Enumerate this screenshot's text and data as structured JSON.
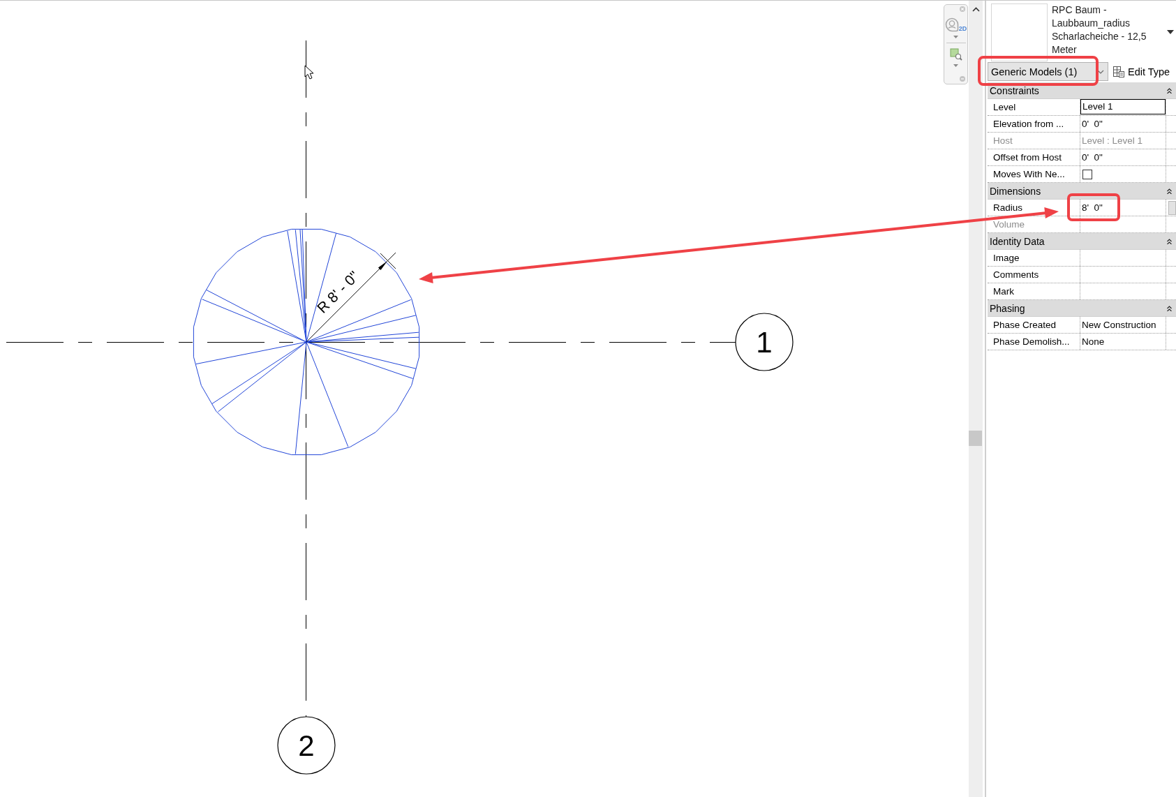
{
  "canvas": {
    "grids": [
      {
        "label": "1",
        "kind": "horizontal"
      },
      {
        "label": "2",
        "kind": "vertical"
      }
    ],
    "dimension": {
      "label": "R 8' - 0\""
    }
  },
  "navigation_bar": {
    "wheel_label": "2D"
  },
  "properties": {
    "type_name": "RPC Baum - Laubbaum_radius Scharlacheiche - 12,5 Meter",
    "category_filter": "Generic Models (1)",
    "edit_type_button": "Edit Type",
    "sections": [
      {
        "title": "Constraints",
        "expanded": true,
        "rows": [
          {
            "name": "Level",
            "kind": "input",
            "value": "Level 1",
            "disabled": false
          },
          {
            "name": "Elevation from ...",
            "kind": "text",
            "value": "0'  0\"",
            "disabled": false
          },
          {
            "name": "Host",
            "kind": "text",
            "value": "Level : Level 1",
            "disabled": true
          },
          {
            "name": "Offset from Host",
            "kind": "text",
            "value": "0'  0\"",
            "disabled": false
          },
          {
            "name": "Moves With Ne...",
            "kind": "checkbox",
            "checked": false,
            "disabled": false
          }
        ]
      },
      {
        "title": "Dimensions",
        "expanded": true,
        "rows": [
          {
            "name": "Radius",
            "kind": "text",
            "value": "8'  0\"",
            "disabled": false
          },
          {
            "name": "Volume",
            "kind": "text",
            "disabled": true
          }
        ]
      },
      {
        "title": "Identity Data",
        "expanded": true,
        "rows": [
          {
            "name": "Image",
            "kind": "text",
            "disabled": false
          },
          {
            "name": "Comments",
            "kind": "text",
            "disabled": false
          },
          {
            "name": "Mark",
            "kind": "text",
            "disabled": false
          }
        ]
      },
      {
        "title": "Phasing",
        "expanded": true,
        "rows": [
          {
            "name": "Phase Created",
            "kind": "text",
            "value": "New Construction",
            "disabled": false
          },
          {
            "name": "Phase Demolish...",
            "kind": "text",
            "value": "None",
            "disabled": false
          }
        ]
      }
    ]
  }
}
